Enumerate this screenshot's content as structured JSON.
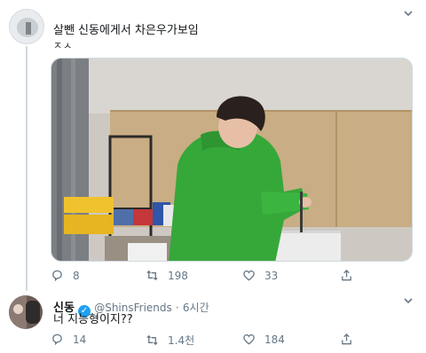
{
  "tweet1": {
    "text_line1": "살뺀 신동에게서 차은우가보임",
    "text_line2": "ㅈㅅ",
    "actions": {
      "replies": "8",
      "retweets": "198",
      "likes": "33"
    }
  },
  "tweet2": {
    "name": "신동",
    "handle": "@ShinsFriends",
    "separator": "·",
    "time": "6시간",
    "text": "너 지능형이지??",
    "actions": {
      "replies": "14",
      "retweets": "1.4천",
      "likes": "184"
    }
  },
  "colors": {
    "accent": "#1da1f2",
    "muted": "#657786",
    "hoodie": "#36a83a"
  }
}
